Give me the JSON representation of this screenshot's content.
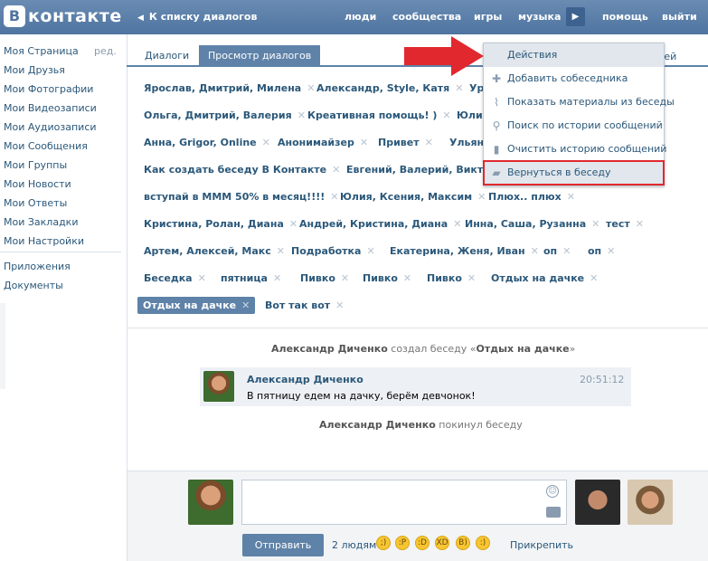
{
  "header": {
    "logo_letter": "В",
    "logo_text": "контакте",
    "back_label": "К списку диалогов",
    "nav": [
      "люди",
      "сообщества",
      "игры",
      "музыка",
      "помощь",
      "выйти"
    ]
  },
  "sidebar": {
    "edit_label": "ред.",
    "items": [
      "Моя Страница",
      "Мои Друзья",
      "Мои Фотографии",
      "Мои Видеозаписи",
      "Мои Аудиозаписи",
      "Мои Сообщения",
      "Мои Группы",
      "Мои Новости",
      "Мои Ответы",
      "Мои Закладки",
      "Мои Настройки"
    ],
    "extra": [
      "Приложения",
      "Документы"
    ]
  },
  "tabs": {
    "dialogs": "Диалоги",
    "view": "Просмотр диалогов",
    "right": "узей"
  },
  "tags": [
    "Ярослав, Дмитрий, Милена",
    "Александр, Style, Катя",
    "Ур",
    "Ольга, Дмитрий, Валерия",
    "Креативная помощь! )",
    "Юли",
    "Анна, Grigor, Online",
    "Анонимайзер",
    "Привет",
    "Ульян",
    "Как создать беседу В Контакте",
    "Евгений, Валерий, Виктор",
    "вступай в МММ 50% в месяц!!!!",
    "Юлия, Ксения, Максим",
    "Плюх.. плюх",
    "Кристина, Ролан, Диана",
    "Андрей, Кристина, Диана",
    "Инна, Саша, Рузанна",
    "тест",
    "Артем, Алексей, Макс",
    "Подработка",
    "Екатерина, Женя, Иван",
    "оп",
    "оп",
    "Беседка",
    "пятница",
    "Пивко",
    "Пивко",
    "Пивко",
    "Отдых на дачке",
    "Отдых на дачке",
    "Вот так вот"
  ],
  "chat": {
    "created_name": "Александр Диченко",
    "created_text": " создал беседу «",
    "created_title": "Отдых на дачке",
    "created_close": "»",
    "message": {
      "author": "Александр Диченко",
      "time": "20:51:12",
      "text": "В пятницу едем на дачку, берём девчонок!"
    },
    "left_name": "Александр Диченко",
    "left_text": " покинул беседу"
  },
  "compose": {
    "send_label": "Отправить",
    "recipients": "2 людям",
    "attach_label": "Прикрепить",
    "emojis": [
      "smile-wink",
      "smile-tongue",
      "smile-grin",
      "smile-laugh",
      "smile-cool",
      "smile-happy"
    ]
  },
  "menu": {
    "header": "Действия",
    "items": [
      {
        "label": "Добавить собеседника",
        "icon": "plus-icon"
      },
      {
        "label": "Показать материалы из беседы",
        "icon": "paperclip-icon"
      },
      {
        "label": "Поиск по истории сообщений",
        "icon": "search-icon"
      },
      {
        "label": "Очистить историю сообщений",
        "icon": "trash-icon"
      },
      {
        "label": "Вернуться в беседу",
        "icon": "speech-bubble-icon"
      }
    ]
  },
  "colors": {
    "header": "#5b7fa6",
    "accent": "#5e82a8",
    "link": "#2b587a",
    "highlight_border": "#e0282e"
  }
}
